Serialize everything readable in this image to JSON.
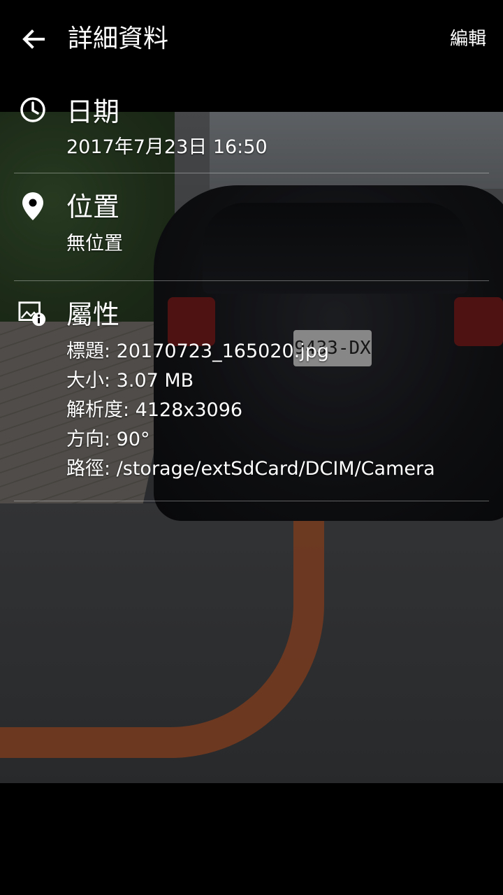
{
  "appbar": {
    "title": "詳細資料",
    "edit_label": "編輯"
  },
  "details": {
    "date": {
      "icon": "clock-icon",
      "title": "日期",
      "value": "2017年7月23日 16:50"
    },
    "location": {
      "icon": "location-pin-icon",
      "title": "位置",
      "value": "無位置"
    },
    "properties": {
      "icon": "image-info-icon",
      "title": "屬性",
      "lines": [
        "標題: 20170723_165020.jpg",
        "大小: 3.07 MB",
        "解析度: 4128x3096",
        "方向: 90°",
        "路徑: /storage/extSdCard/DCIM/Camera"
      ]
    }
  },
  "photo": {
    "plate_text": "9433-DX"
  },
  "colors": {
    "background": "#000000",
    "text": "#ffffff",
    "divider": "rgba(255,255,255,0.35)",
    "curb_paint": "#b85a2f"
  }
}
